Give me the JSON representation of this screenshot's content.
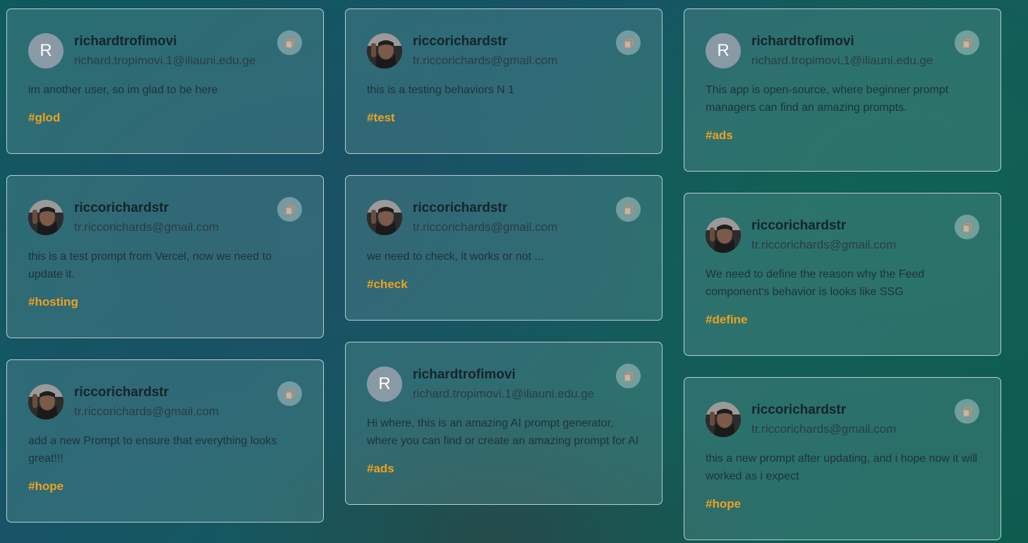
{
  "feed": {
    "columns": [
      [
        {
          "author": {
            "username": "richardtrofimovi",
            "email": "richard.tropimovi.1@iliauni.edu.ge",
            "avatar_letter": "R",
            "avatar": "letter"
          },
          "prompt": "im another user, so im glad to be here",
          "tag": "#glod"
        },
        {
          "author": {
            "username": "riccorichardstr",
            "email": "tr.riccorichards@gmail.com",
            "avatar_letter": "",
            "avatar": "photo"
          },
          "prompt": "this is a test prompt from Vercel, now we need to update it.",
          "tag": "#hosting"
        },
        {
          "author": {
            "username": "riccorichardstr",
            "email": "tr.riccorichards@gmail.com",
            "avatar_letter": "",
            "avatar": "photo"
          },
          "prompt": "add a new Prompt to ensure that everything looks great!!!",
          "tag": "#hope"
        }
      ],
      [
        {
          "author": {
            "username": "riccorichardstr",
            "email": "tr.riccorichards@gmail.com",
            "avatar_letter": "",
            "avatar": "photo"
          },
          "prompt": "this is a testing behaviors N 1",
          "tag": "#test"
        },
        {
          "author": {
            "username": "riccorichardstr",
            "email": "tr.riccorichards@gmail.com",
            "avatar_letter": "",
            "avatar": "photo"
          },
          "prompt": "we need to check, it works or not ...",
          "tag": "#check"
        },
        {
          "author": {
            "username": "richardtrofimovi",
            "email": "richard.tropimovi.1@iliauni.edu.ge",
            "avatar_letter": "R",
            "avatar": "letter"
          },
          "prompt": "Hi where, this is an amazing AI prompt generator, where you can find or create an amazing prompt for AI",
          "tag": "#ads"
        }
      ],
      [
        {
          "author": {
            "username": "richardtrofimovi",
            "email": "richard.tropimovi.1@iliauni.edu.ge",
            "avatar_letter": "R",
            "avatar": "letter"
          },
          "prompt": "This app is open-source, where beginner prompt managers can find an amazing prompts.",
          "tag": "#ads"
        },
        {
          "author": {
            "username": "riccorichardstr",
            "email": "tr.riccorichards@gmail.com",
            "avatar_letter": "",
            "avatar": "photo"
          },
          "prompt": "We need to define the reason why the Feed component's behavior is looks like SSG",
          "tag": "#define"
        },
        {
          "author": {
            "username": "riccorichardstr",
            "email": "tr.riccorichards@gmail.com",
            "avatar_letter": "",
            "avatar": "photo"
          },
          "prompt": "this a new prompt after updating, and i hope now it will worked as i expect",
          "tag": "#hope"
        }
      ]
    ]
  },
  "icons": {
    "copy": "copy-icon",
    "avatar_photo": "user-photo-avatar"
  },
  "colors": {
    "tag": "#f0a020",
    "avatar_letter_bg": "#8a99a6",
    "copy_icon": "#e0865a"
  }
}
